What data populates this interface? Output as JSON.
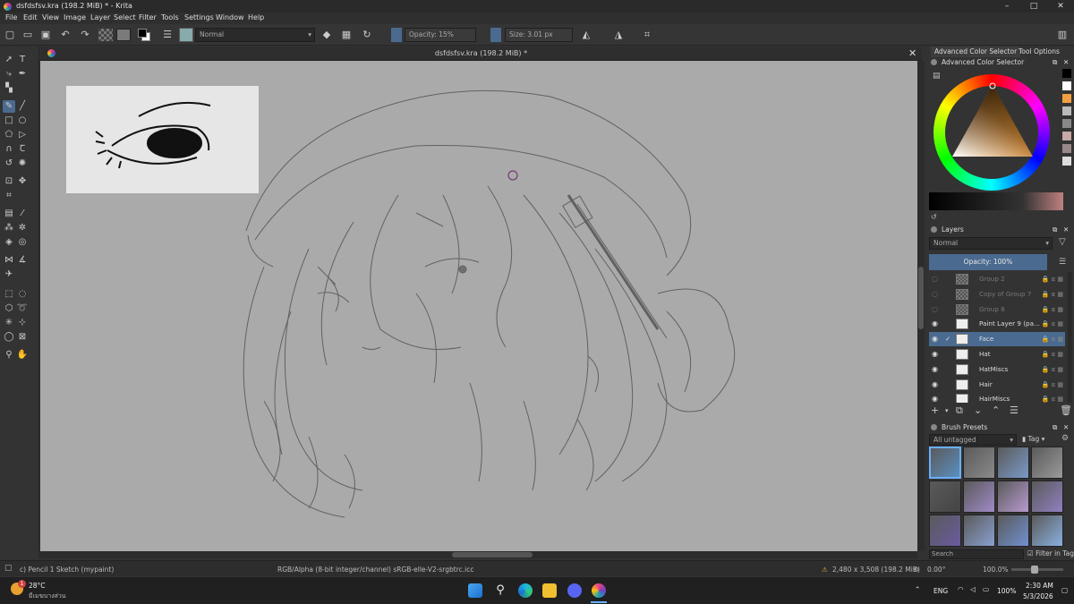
{
  "window": {
    "title": "dsfdsfsv.kra (198.2 MiB) * - Krita",
    "controls": [
      "–",
      "□",
      "✕"
    ]
  },
  "menu": [
    "File",
    "Edit",
    "View",
    "Image",
    "Layer",
    "Select",
    "Filter",
    "Tools",
    "Settings",
    "Window",
    "Help"
  ],
  "toolbar": {
    "blend_mode": "Normal",
    "opacity": "Opacity: 15%",
    "size": "Size: 3.01 px"
  },
  "document": {
    "tab_title": "dsfdsfsv.kra (198.2 MiB) *"
  },
  "dock": {
    "tabs": [
      "Advanced Color Selector",
      "Tool Options"
    ],
    "color_panel_title": "Advanced Color Selector",
    "layers_title": "Layers",
    "layers_blend": "Normal",
    "layers_opacity": "Opacity: 100%",
    "layers": [
      {
        "name": "Group 2",
        "visible": false,
        "selected": false,
        "kind": "group"
      },
      {
        "name": "Copy of Group 7",
        "visible": false,
        "selected": false,
        "kind": "group"
      },
      {
        "name": "Group 8",
        "visible": false,
        "selected": false,
        "kind": "group"
      },
      {
        "name": "Paint Layer 9 (pa...",
        "visible": true,
        "selected": false,
        "kind": "paint"
      },
      {
        "name": "Face",
        "visible": true,
        "selected": true,
        "kind": "paint"
      },
      {
        "name": "Hat",
        "visible": true,
        "selected": false,
        "kind": "paint"
      },
      {
        "name": "HatMiscs",
        "visible": true,
        "selected": false,
        "kind": "paint"
      },
      {
        "name": "Hair",
        "visible": true,
        "selected": false,
        "kind": "paint"
      },
      {
        "name": "HairMiscs",
        "visible": true,
        "selected": false,
        "kind": "paint"
      }
    ],
    "brush_presets_title": "Brush Presets",
    "brush_tag": "All untagged",
    "tag_button": "Tag",
    "search_placeholder": "Search",
    "filter_in_tag": "Filter in Tag"
  },
  "statusbar": {
    "brush": "c) Pencil 1 Sketch (mypaint)",
    "colorspace": "RGB/Alpha (8-bit integer/channel)  sRGB-elle-V2-srgbtrc.icc",
    "dimensions": "2,480 x 3,508 (198.2 MiB)",
    "rotation": "0.00°",
    "zoom": "100.0%"
  },
  "taskbar": {
    "temperature": "28°C",
    "weather": "มีเมฆบางส่วน",
    "lang": "ENG",
    "battery": "100%",
    "time": "2:30 AM",
    "date": "5/3/2026",
    "badge": "1"
  }
}
